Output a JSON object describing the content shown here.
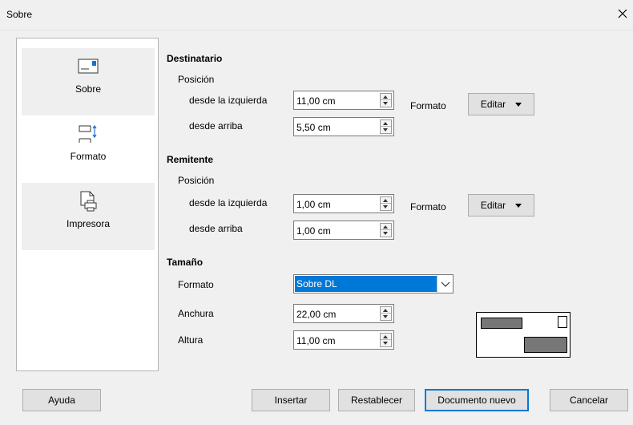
{
  "window": {
    "title": "Sobre"
  },
  "nav": [
    {
      "label": "Sobre",
      "icon": "envelope-icon",
      "selected": false
    },
    {
      "label": "Formato",
      "icon": "format-layout-icon",
      "selected": true
    },
    {
      "label": "Impresora",
      "icon": "printer-icon",
      "selected": false
    }
  ],
  "recipient": {
    "heading": "Destinatario",
    "position_label": "Posición",
    "left_label": "desde la izquierda",
    "left_value": "11,00 cm",
    "top_label": "desde arriba",
    "top_value": "5,50 cm",
    "format_label": "Formato",
    "edit_label": "Editar"
  },
  "sender": {
    "heading": "Remitente",
    "position_label": "Posición",
    "left_label": "desde la izquierda",
    "left_value": "1,00 cm",
    "top_label": "desde arriba",
    "top_value": "1,00 cm",
    "format_label": "Formato",
    "edit_label": "Editar"
  },
  "size": {
    "heading": "Tamaño",
    "format_label": "Formato",
    "format_value": "Sobre DL",
    "width_label": "Anchura",
    "width_value": "22,00 cm",
    "height_label": "Altura",
    "height_value": "11,00 cm"
  },
  "buttons": {
    "help": "Ayuda",
    "insert": "Insertar",
    "reset": "Restablecer",
    "new_document": "Documento nuevo",
    "cancel": "Cancelar"
  },
  "colors": {
    "accent": "#0078d7",
    "preview_fill": "#777777"
  }
}
